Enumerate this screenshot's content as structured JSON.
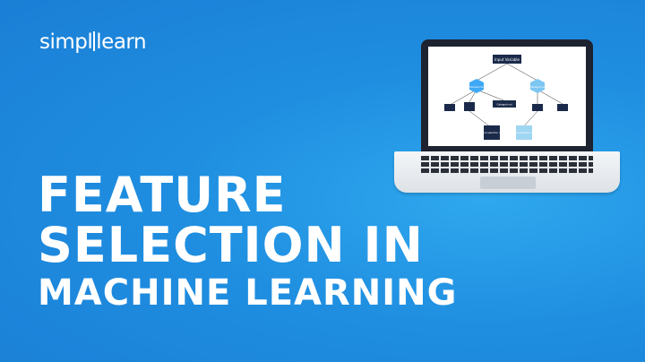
{
  "brand": {
    "logo_left": "simpl",
    "logo_right": "learn"
  },
  "headline": {
    "line1": "FEATURE",
    "line2": "SELECTION IN",
    "line3": "MACHINE LEARNING"
  },
  "diagram": {
    "top_box": "Input Variable",
    "left_hex": "Numerical",
    "right_hex": "Categorical",
    "center_box": "Categorical",
    "left_result": "Feature selection result",
    "right_result": "Feature selection result"
  },
  "colors": {
    "background": "#1f8ee0",
    "navy": "#1b2a4a",
    "hex_blue": "#3fa9f5",
    "light_blue": "#9fd6f2"
  }
}
